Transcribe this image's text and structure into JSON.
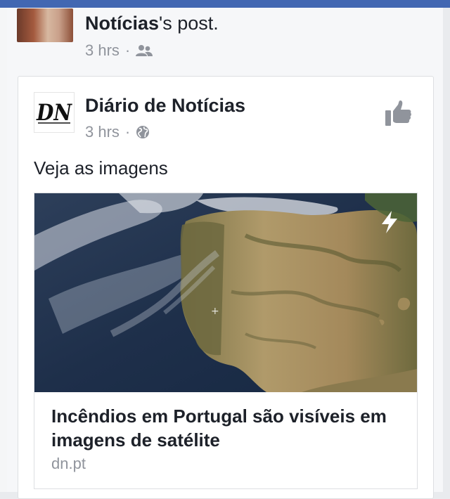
{
  "share": {
    "page_name": "Notícias",
    "suffix": "'s post.",
    "time": "3 hrs",
    "dot": "·",
    "audience_icon": "friends-icon"
  },
  "post": {
    "page_name": "Diário de Notícias",
    "logo_text": "DN",
    "time": "3 hrs",
    "dot": "·",
    "privacy_icon": "globe-icon",
    "action_icon": "like-icon",
    "text": "Veja as imagens"
  },
  "link": {
    "title": "Incêndios em Portugal são visíveis em imagens de satélite",
    "domain": "dn.pt",
    "badge_icon": "lightning-icon"
  },
  "colors": {
    "brand_blue": "#4267b2",
    "meta_gray": "#90949c",
    "text": "#1d2129"
  }
}
